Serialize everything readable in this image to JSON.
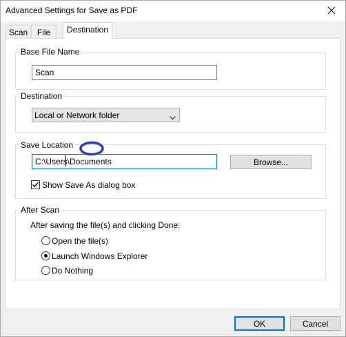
{
  "window": {
    "title": "Advanced Settings for Save as PDF"
  },
  "tabs": [
    {
      "label": "Scan"
    },
    {
      "label": "File"
    },
    {
      "label": "Destination",
      "active": true
    }
  ],
  "base_file_name": {
    "legend": "Base File Name",
    "value": "Scan"
  },
  "destination": {
    "legend": "Destination",
    "selected": "Local or Network folder"
  },
  "save_location": {
    "legend": "Save Location",
    "path": "C:\\Users\\Documents",
    "browse_label": "Browse...",
    "show_dialog_label": "Show Save As dialog box",
    "show_dialog_checked": true
  },
  "after_scan": {
    "legend": "After Scan",
    "prompt": "After saving the file(s) and clicking Done:",
    "options": [
      {
        "label": "Open the file(s)",
        "selected": false
      },
      {
        "label": "Launch Windows Explorer",
        "selected": true
      },
      {
        "label": "Do Nothing",
        "selected": false
      }
    ]
  },
  "footer": {
    "ok_label": "OK",
    "cancel_label": "Cancel"
  },
  "colors": {
    "accent": "#0078d7",
    "annotation": "#2a3cb0"
  }
}
